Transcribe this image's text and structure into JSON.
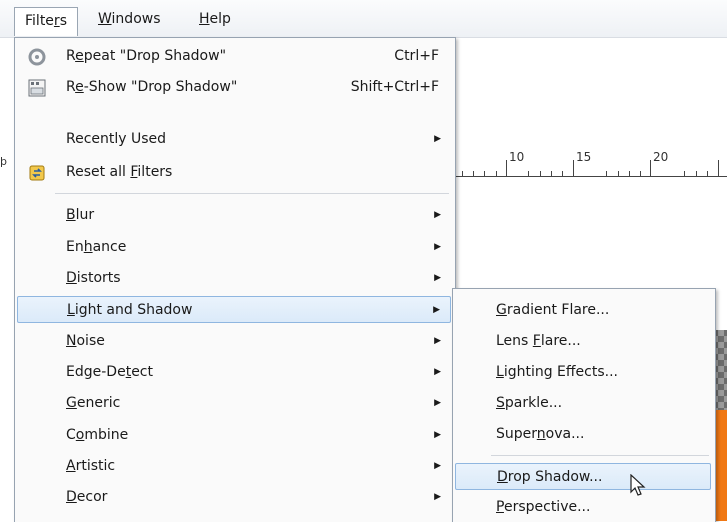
{
  "menubar": {
    "items": [
      {
        "pre": "Filte",
        "u": "r",
        "post": "s"
      },
      {
        "pre": "",
        "u": "W",
        "post": "indows"
      },
      {
        "pre": "",
        "u": "H",
        "post": "elp"
      }
    ]
  },
  "ruler": {
    "labels": [
      "10",
      "15",
      "20"
    ]
  },
  "filters_menu": {
    "repeat": {
      "pre": "R",
      "u": "e",
      "post": "peat \"Drop Shadow\"",
      "accel": "Ctrl+F",
      "icon": "repeat-filter-icon"
    },
    "reshow": {
      "pre": "R",
      "u": "e",
      "post": "-Show \"Drop Shadow\"",
      "accel": "Shift+Ctrl+F",
      "icon": "reshow-filter-icon"
    },
    "recent": {
      "label": "Recently Used"
    },
    "reset": {
      "pre": "Reset all ",
      "u": "F",
      "post": "ilters",
      "icon": "reset-filters-icon"
    },
    "items": [
      {
        "pre": "",
        "u": "B",
        "post": "lur"
      },
      {
        "pre": "En",
        "u": "h",
        "post": "ance"
      },
      {
        "pre": "",
        "u": "D",
        "post": "istorts"
      },
      {
        "pre": "",
        "u": "L",
        "post": "ight and Shadow"
      },
      {
        "pre": "",
        "u": "N",
        "post": "oise"
      },
      {
        "pre": "Edge-De",
        "u": "t",
        "post": "ect"
      },
      {
        "pre": "",
        "u": "G",
        "post": "eneric"
      },
      {
        "pre": "C",
        "u": "o",
        "post": "mbine"
      },
      {
        "pre": "",
        "u": "A",
        "post": "rtistic"
      },
      {
        "pre": "",
        "u": "D",
        "post": "ecor"
      }
    ]
  },
  "submenu": {
    "items": [
      {
        "pre": "",
        "u": "G",
        "post": "radient Flare..."
      },
      {
        "pre": "Lens ",
        "u": "F",
        "post": "lare..."
      },
      {
        "pre": "",
        "u": "L",
        "post": "ighting Effects..."
      },
      {
        "pre": "",
        "u": "S",
        "post": "parkle..."
      },
      {
        "pre": "Super",
        "u": "n",
        "post": "ova..."
      },
      {
        "pre": "",
        "u": "D",
        "post": "rop Shadow..."
      },
      {
        "pre": "",
        "u": "P",
        "post": "erspective..."
      }
    ]
  },
  "colors": {
    "highlight": "#dbeaf9",
    "highlight_border": "#8fb6e0",
    "canvas_orange": "#f07814"
  }
}
